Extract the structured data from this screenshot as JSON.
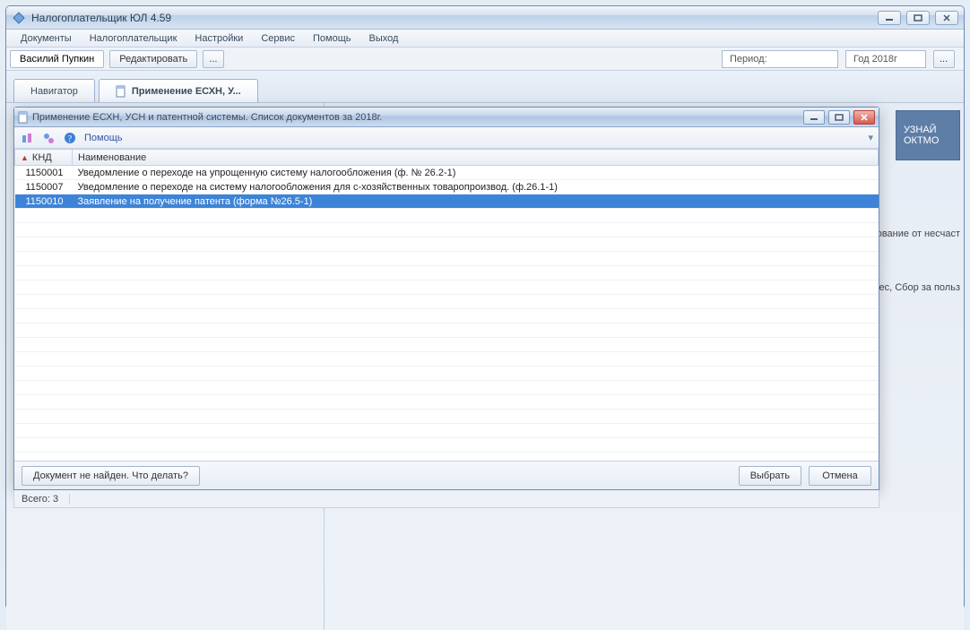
{
  "app": {
    "title": "Налогоплательщик ЮЛ 4.59"
  },
  "menu": {
    "items": [
      "Документы",
      "Налогоплательщик",
      "Настройки",
      "Сервис",
      "Помощь",
      "Выход"
    ]
  },
  "user": {
    "name": "Василий Пупкин",
    "edit_label": "Редактировать",
    "more_label": "..."
  },
  "period": {
    "label": "Период:",
    "value": "Год 2018г",
    "more_label": "..."
  },
  "tabs": {
    "navigator": "Навигатор",
    "active": "Применение ЕСХН, У..."
  },
  "side": {
    "chip_line1": "УЗНАЙ",
    "chip_line2": "ОКТМО",
    "text1": "кование от несчаст",
    "text2": "знес, Сбор за польз"
  },
  "child": {
    "title": "Применение ЕСХН, УСН и патентной системы. Список документов за 2018г.",
    "help": "Помощь",
    "columns": {
      "knd": "КНД",
      "name": "Наименование"
    },
    "rows": [
      {
        "knd": "1150001",
        "name": "Уведомление о переходе на упрощенную систему налогообложения (ф. № 26.2-1)",
        "selected": false
      },
      {
        "knd": "1150007",
        "name": "Уведомление  о переходе на систему налогообложения  для с-хозяйственных товаропроизвод. (ф.26.1-1)",
        "selected": false
      },
      {
        "knd": "1150010",
        "name": "Заявление на получение патента (форма №26.5-1)",
        "selected": true
      }
    ],
    "not_found_label": "Документ не найден. Что делать?",
    "select_label": "Выбрать",
    "cancel_label": "Отмена",
    "status_total": "Всего: 3"
  }
}
